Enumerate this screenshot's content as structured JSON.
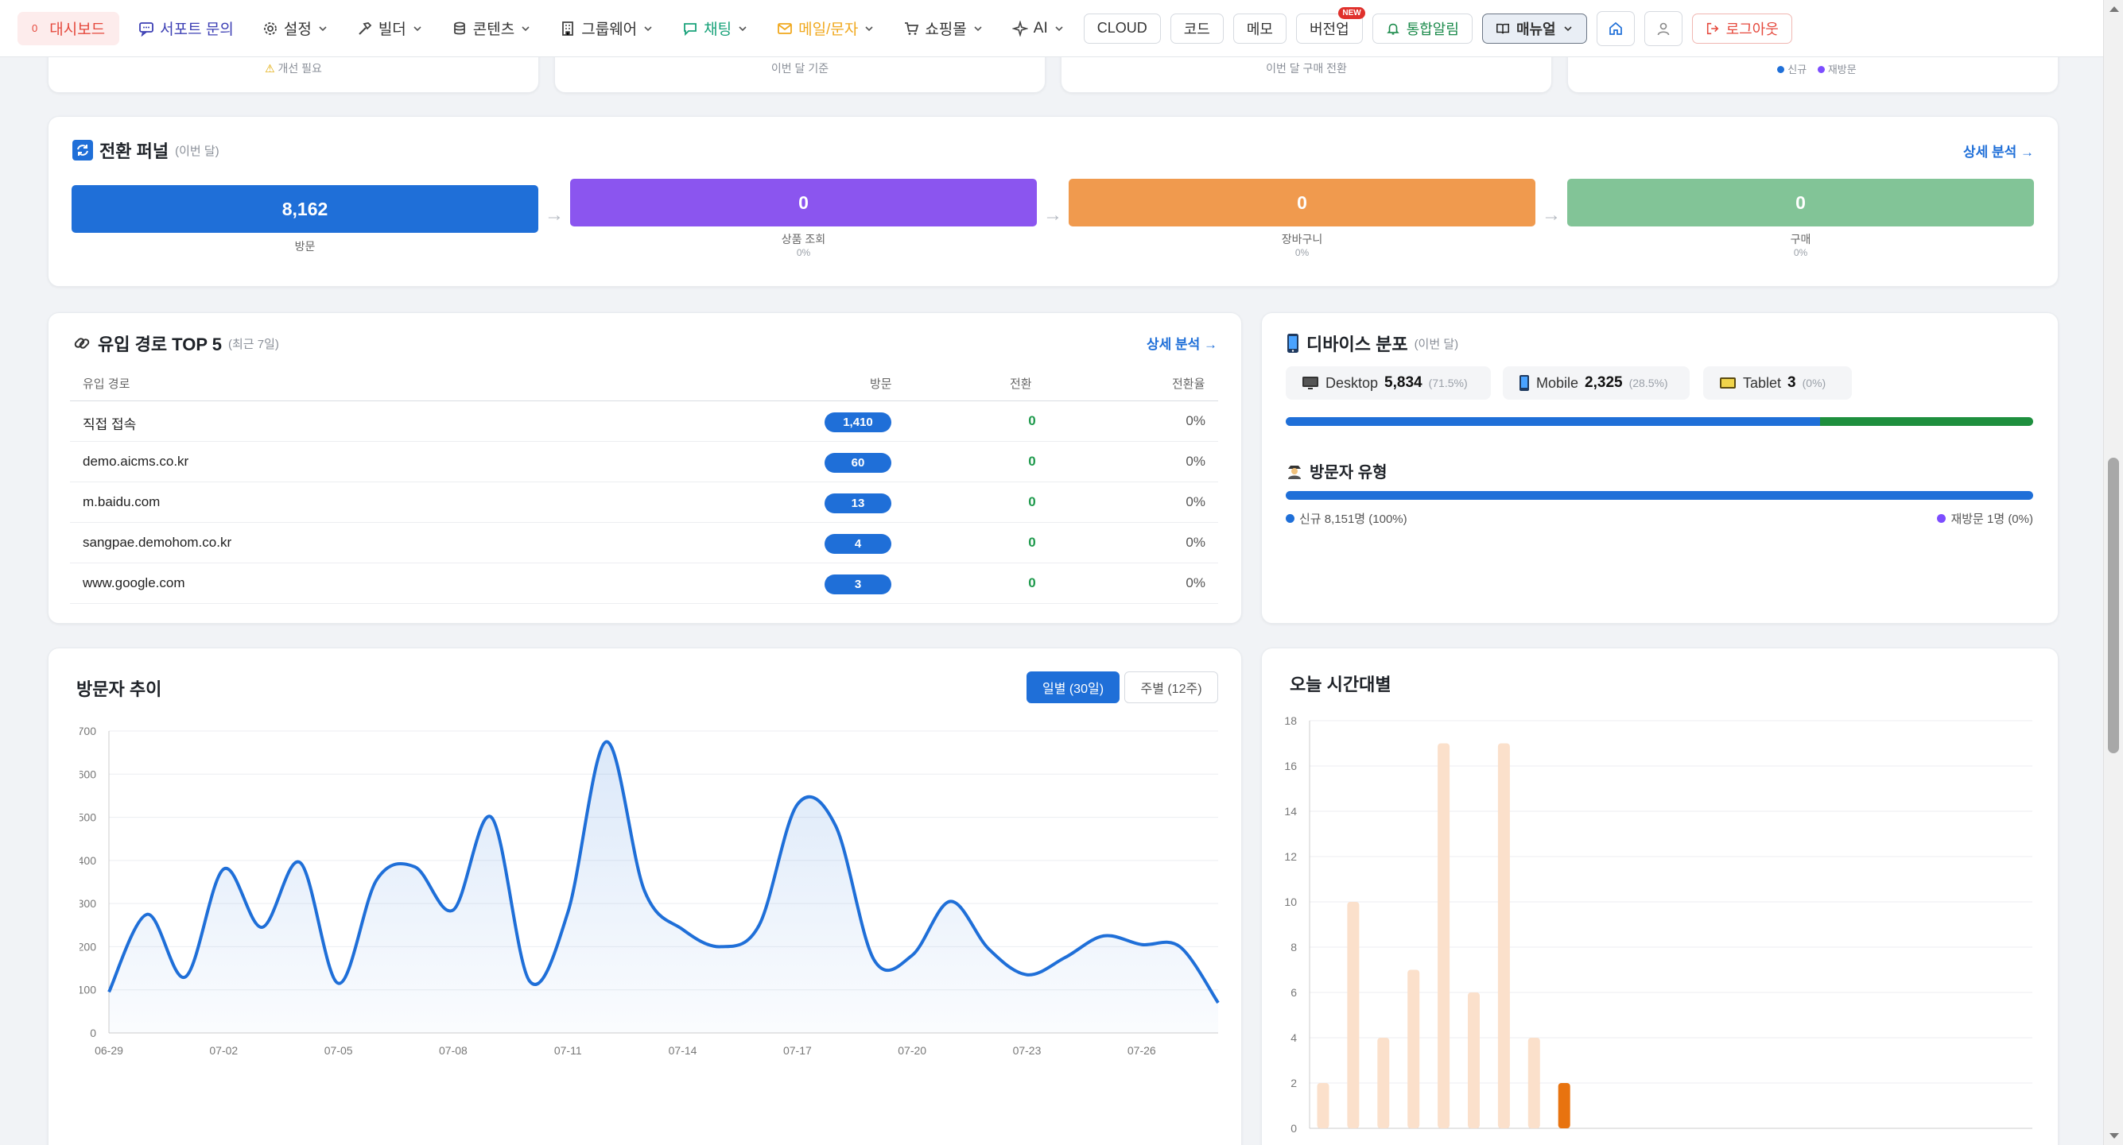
{
  "nav": {
    "dashboard": {
      "badge": "0",
      "label": "대시보드"
    },
    "support": "서포트 문의",
    "settings": "설정",
    "builder": "빌더",
    "contents": "콘텐츠",
    "groupware": "그룹웨어",
    "chat": "채팅",
    "mail": "메일/문자",
    "shop": "쇼핑몰",
    "ai": "AI",
    "cloud": "CLOUD",
    "code": "코드",
    "memo": "메모",
    "upgrade": "버전업",
    "upgrade_badge": "NEW",
    "alarm": "통합알림",
    "manual": "매뉴얼",
    "logout": "로그아웃"
  },
  "top_cards": {
    "card1_sub": "개선 필요",
    "card2_sub": "이번 달 기준",
    "card3_sub": "이번 달 구매 전환",
    "card4_legend": [
      "신규",
      "재방문"
    ]
  },
  "funnel": {
    "title": "전환 퍼널",
    "period": "(이번 달)",
    "more": "상세 분석 →",
    "steps": [
      {
        "value": "8,162",
        "label": "방문",
        "pct": "",
        "color": "#1f6fd8"
      },
      {
        "value": "0",
        "label": "상품 조회",
        "pct": "0%",
        "color": "#8b55ef"
      },
      {
        "value": "0",
        "label": "장바구니",
        "pct": "0%",
        "color": "#f09a4e"
      },
      {
        "value": "0",
        "label": "구매",
        "pct": "0%",
        "color": "#82c497"
      }
    ]
  },
  "sources": {
    "title": "유입 경로 TOP 5",
    "period": "(최근 7일)",
    "more": "상세 분석 →",
    "headers": [
      "유입 경로",
      "방문",
      "전환",
      "전환율"
    ],
    "rows": [
      {
        "source": "직접 접속",
        "visits": "1,410",
        "conversions": "0",
        "rate": "0%"
      },
      {
        "source": "demo.aicms.co.kr",
        "visits": "60",
        "conversions": "0",
        "rate": "0%"
      },
      {
        "source": "m.baidu.com",
        "visits": "13",
        "conversions": "0",
        "rate": "0%"
      },
      {
        "source": "sangpae.demohom.co.kr",
        "visits": "4",
        "conversions": "0",
        "rate": "0%"
      },
      {
        "source": "www.google.com",
        "visits": "3",
        "conversions": "0",
        "rate": "0%"
      }
    ]
  },
  "devices": {
    "title": "디바이스 분포",
    "period": "(이번 달)",
    "items": [
      {
        "name": "Desktop",
        "count": "5,834",
        "pct": "(71.5%)",
        "share": 0.715,
        "color": "#1f6fd8"
      },
      {
        "name": "Mobile",
        "count": "2,325",
        "pct": "(28.5%)",
        "share": 0.285,
        "color": "#1e8f3e"
      },
      {
        "name": "Tablet",
        "count": "3",
        "pct": "(0%)",
        "share": 0.0,
        "color": "#f0c419"
      }
    ],
    "visitor_type": {
      "title": "방문자 유형",
      "new_label": "신규 8,151명 (100%)",
      "return_label": "재방문 1명 (0%)",
      "new_share": 1.0,
      "new_color": "#1f6fd8",
      "return_color": "#7c4dff"
    }
  },
  "visitor_trend": {
    "title": "방문자 추이",
    "tab_daily": "일별 (30일)",
    "tab_weekly": "주별 (12주)"
  },
  "hourly": {
    "title": "오늘 시간대별"
  },
  "chart_data": [
    {
      "type": "area",
      "title": "방문자 추이",
      "x": [
        "06-29",
        "06-30",
        "07-01",
        "07-02",
        "07-03",
        "07-04",
        "07-05",
        "07-06",
        "07-07",
        "07-08",
        "07-09",
        "07-10",
        "07-11",
        "07-12",
        "07-13",
        "07-14",
        "07-15",
        "07-16",
        "07-17",
        "07-18",
        "07-19",
        "07-20",
        "07-21",
        "07-22",
        "07-23",
        "07-24",
        "07-25",
        "07-26",
        "07-27",
        "07-28"
      ],
      "x_ticks": [
        "06-29",
        "07-02",
        "07-05",
        "07-08",
        "07-11",
        "07-14",
        "07-17",
        "07-20",
        "07-23",
        "07-26"
      ],
      "values": [
        95,
        275,
        130,
        380,
        245,
        395,
        115,
        355,
        385,
        285,
        500,
        120,
        280,
        675,
        330,
        240,
        200,
        250,
        530,
        480,
        170,
        180,
        305,
        195,
        135,
        175,
        225,
        205,
        200,
        70
      ],
      "ylim": [
        0,
        700
      ],
      "y_ticks": [
        0,
        100,
        200,
        300,
        400,
        500,
        600,
        700
      ],
      "color": "#1f6fd8",
      "grid": true
    },
    {
      "type": "bar",
      "title": "오늘 시간대별",
      "categories": [
        0,
        1,
        2,
        3,
        4,
        5,
        6,
        7,
        8,
        9,
        10,
        11,
        12,
        13,
        14,
        15,
        16,
        17,
        18,
        19,
        20,
        21,
        22,
        23
      ],
      "values": [
        2,
        10,
        4,
        7,
        17,
        6,
        17,
        4,
        2,
        0,
        0,
        0,
        0,
        0,
        0,
        0,
        0,
        0,
        0,
        0,
        0,
        0,
        0,
        0
      ],
      "current_hour": 8,
      "ylim": [
        0,
        18
      ],
      "y_ticks": [
        0,
        2,
        4,
        6,
        8,
        10,
        12,
        14,
        16,
        18
      ],
      "color": "#fbe0cb",
      "current_color": "#e8730f",
      "grid": true
    }
  ]
}
